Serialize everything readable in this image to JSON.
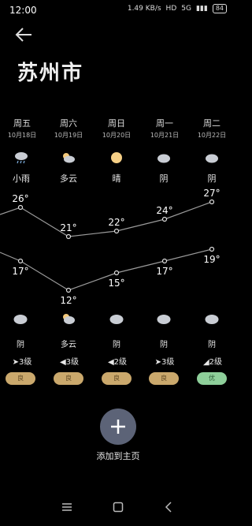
{
  "status": {
    "time": "12:00",
    "net_speed": "1.49 KB/s",
    "signal": "5G",
    "battery": "84"
  },
  "city": "苏州市",
  "days": [
    {
      "name": "周五",
      "date": "10月18日",
      "top_icon": "rain-cloud-icon",
      "top_condition": "小雨",
      "high": "26°",
      "low": "17°",
      "bottom_icon": "cloud-icon",
      "bottom_condition": "阴",
      "wind": "➤3级",
      "aqi": "良",
      "aqi_color": "#caa86c"
    },
    {
      "name": "周六",
      "date": "10月19日",
      "top_icon": "partly-cloudy-icon",
      "top_condition": "多云",
      "high": "21°",
      "low": "12°",
      "bottom_icon": "partly-cloudy-icon",
      "bottom_condition": "多云",
      "wind": "◀3级",
      "aqi": "良",
      "aqi_color": "#caa86c"
    },
    {
      "name": "周日",
      "date": "10月20日",
      "top_icon": "sun-icon",
      "top_condition": "晴",
      "high": "22°",
      "low": "15°",
      "bottom_icon": "cloud-icon",
      "bottom_condition": "阴",
      "wind": "◀2级",
      "aqi": "良",
      "aqi_color": "#caa86c"
    },
    {
      "name": "周一",
      "date": "10月21日",
      "top_icon": "cloud-icon",
      "top_condition": "阴",
      "high": "24°",
      "low": "17°",
      "bottom_icon": "cloud-icon",
      "bottom_condition": "阴",
      "wind": "➤3级",
      "aqi": "良",
      "aqi_color": "#caa86c"
    },
    {
      "name": "周二",
      "date": "10月22日",
      "top_icon": "cloud-icon",
      "top_condition": "阴",
      "high": "27°",
      "low": "19°",
      "bottom_icon": "cloud-icon",
      "bottom_condition": "阴",
      "wind": "◢2级",
      "aqi": "优",
      "aqi_color": "#8ecf9a"
    }
  ],
  "add_button_label": "添加到主页",
  "colors": {
    "background": "#000000",
    "add_button": "#5c6377",
    "aqi_good": "#caa86c",
    "aqi_excellent": "#8ecf9a"
  }
}
